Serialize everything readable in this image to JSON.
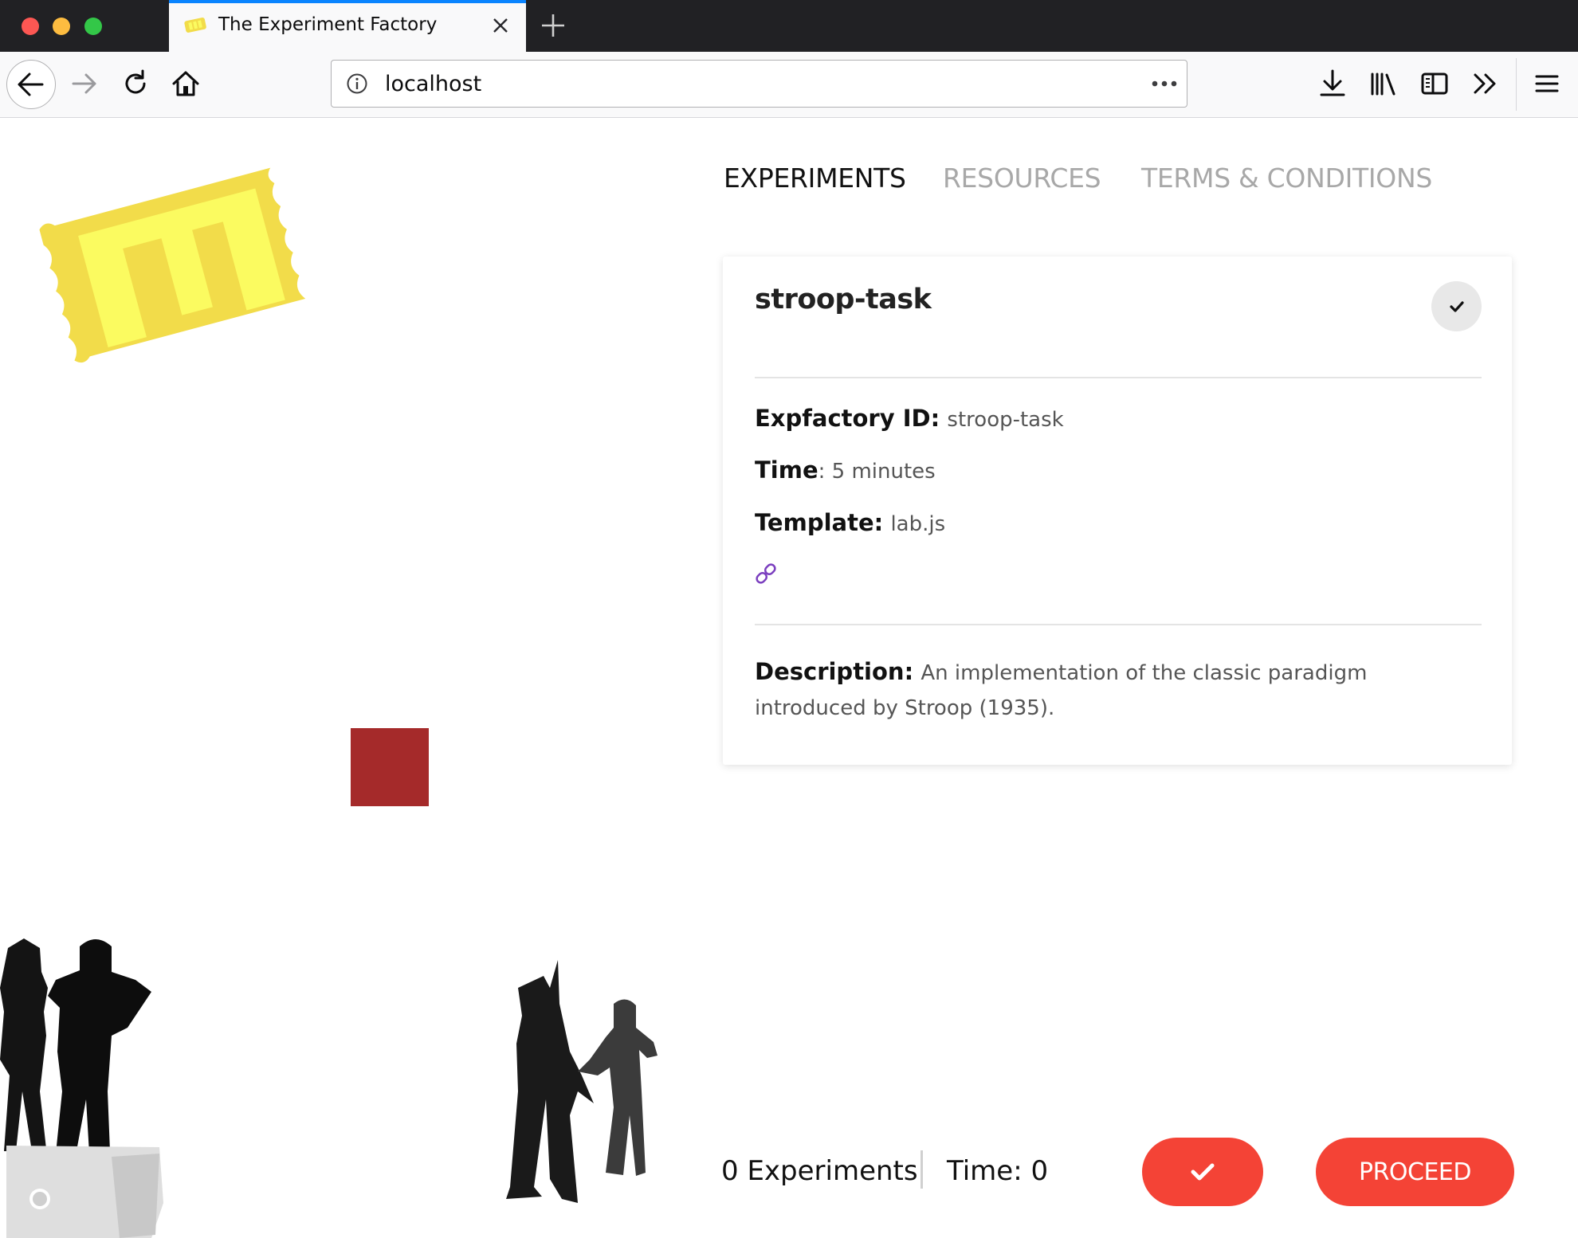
{
  "browser": {
    "tab_title": "The Experiment Factory",
    "url": "localhost"
  },
  "nav": {
    "items": [
      {
        "label": "EXPERIMENTS",
        "active": true
      },
      {
        "label": "RESOURCES",
        "active": false
      },
      {
        "label": "TERMS & CONDITIONS",
        "active": false
      }
    ]
  },
  "card": {
    "title": "stroop-task",
    "fields": {
      "expfactory_id_label": "Expfactory ID:",
      "expfactory_id_value": "stroop-task",
      "time_label": "Time",
      "time_value": ": 5 minutes",
      "template_label": "Template:",
      "template_value": "lab.js"
    },
    "description_label": "Description:",
    "description_value": "An implementation of the classic paradigm introduced by Stroop (1935)."
  },
  "footer": {
    "experiments_count": "0 Experiments",
    "time": "Time: 0",
    "proceed_label": "PROCEED"
  },
  "colors": {
    "accent_red": "#f44336",
    "logo_yellow": "#f2dc4a",
    "logo_light": "#fbfb60",
    "square_red": "#a52a2a",
    "tab_highlight": "#0a84ff",
    "link_purple": "#7b3fbf"
  },
  "icons": {
    "link": "link-icon",
    "check": "checkmark-icon"
  }
}
